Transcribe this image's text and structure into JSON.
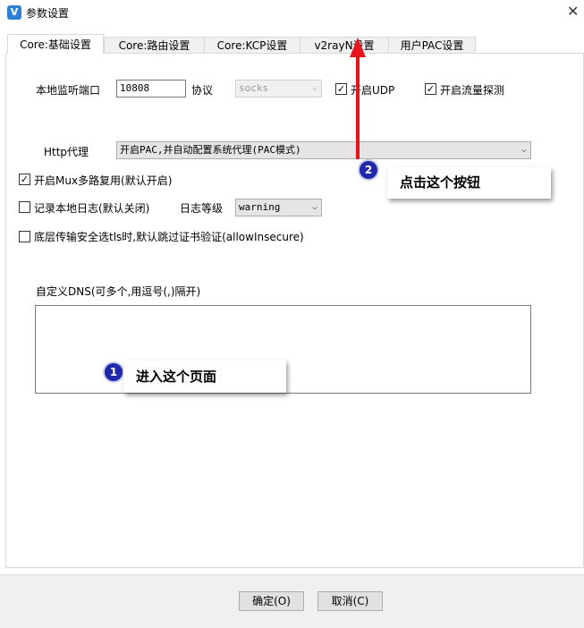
{
  "window": {
    "title": "参数设置",
    "close_glyph": "✕"
  },
  "tabs": [
    {
      "label": "Core:基础设置",
      "active": true
    },
    {
      "label": "Core:路由设置",
      "active": false
    },
    {
      "label": "Core:KCP设置",
      "active": false
    },
    {
      "label": "v2rayN设置",
      "active": false
    },
    {
      "label": "用户PAC设置",
      "active": false
    }
  ],
  "form": {
    "local_port_label": "本地监听端口",
    "local_port_value": "10808",
    "protocol_label": "协议",
    "protocol_value": "socks",
    "udp_label": "开启UDP",
    "udp_checked": true,
    "sniffing_label": "开启流量探测",
    "sniffing_checked": true,
    "http_proxy_label": "Http代理",
    "http_proxy_value": "开启PAC,并自动配置系统代理(PAC模式)",
    "mux_label": "开启Mux多路复用(默认开启)",
    "mux_checked": true,
    "log_label": "记录本地日志(默认关闭)",
    "log_checked": false,
    "log_level_label": "日志等级",
    "log_level_value": "warning",
    "allow_insecure_label": "底层传输安全选tls时,默认跳过证书验证(allowInsecure)",
    "allow_insecure_checked": false,
    "dns_label": "自定义DNS(可多个,用逗号(,)隔开)",
    "dns_value": ""
  },
  "footer": {
    "ok_label": "确定(O)",
    "cancel_label": "取消(C)"
  },
  "annotations": [
    {
      "number": "1",
      "text": "进入这个页面"
    },
    {
      "number": "2",
      "text": "点击这个按钮"
    }
  ],
  "icons": {
    "checkbox_checked": "✓",
    "dropdown_arrow": "⌵"
  },
  "colors": {
    "annotation_arrow": "#e8141c",
    "badge": "#1e28a8",
    "app_icon": "#2d7fd8"
  }
}
